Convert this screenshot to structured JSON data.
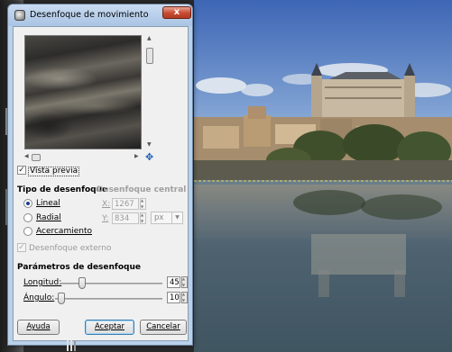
{
  "window": {
    "title": "Desenfoque de movimiento",
    "close_label": "x"
  },
  "preview": {
    "checkbox_label": "Vista previa",
    "checked": true
  },
  "blur_type": {
    "title": "Tipo de desenfoque",
    "options": [
      {
        "label": "Lineal",
        "checked": true
      },
      {
        "label": "Radial",
        "checked": false
      },
      {
        "label": "Acercamiento",
        "checked": false
      }
    ]
  },
  "center": {
    "title": "Desenfoque central",
    "x_label": "X:",
    "x_value": "1267",
    "y_label": "Y:",
    "y_value": "834",
    "unit": "px"
  },
  "outer_blur": {
    "label": "Desenfoque externo",
    "checked": true
  },
  "params": {
    "title": "Parámetros de desenfoque",
    "length_label": "Longitud:",
    "length_value": "45",
    "angle_label": "Ángulo:",
    "angle_value": "10"
  },
  "buttons": {
    "help": "Ayuda",
    "accept": "Aceptar",
    "cancel": "Cancelar"
  },
  "colors": {
    "title_bar": "#b9d1ea",
    "close_button": "#c74a31",
    "selection_guide": "#e8d65a"
  }
}
